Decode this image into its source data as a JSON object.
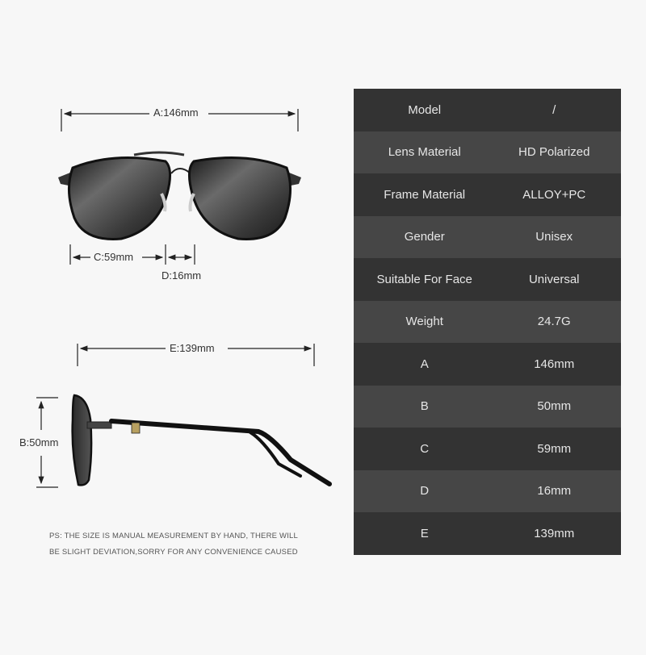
{
  "diagram": {
    "front_view": {
      "width_label": "A:146mm",
      "lens_width_label": "C:59mm",
      "bridge_label": "D:16mm"
    },
    "side_view": {
      "temple_length_label": "E:139mm",
      "lens_height_label": "B:50mm"
    },
    "note_lines": [
      "PS: THE SIZE IS MANUAL MEASUREMENT BY HAND, THERE WILL",
      "BE SLIGHT DEVIATION,SORRY FOR ANY CONVENIENCE CAUSED"
    ]
  },
  "specs": [
    {
      "label": "Model",
      "value": "/"
    },
    {
      "label": "Lens Material",
      "value": "HD Polarized"
    },
    {
      "label": "Frame Material",
      "value": "ALLOY+PC"
    },
    {
      "label": "Gender",
      "value": "Unisex"
    },
    {
      "label": "Suitable For Face",
      "value": "Universal"
    },
    {
      "label": "Weight",
      "value": "24.7G"
    },
    {
      "label": "A",
      "value": "146mm"
    },
    {
      "label": "B",
      "value": "50mm"
    },
    {
      "label": "C",
      "value": "59mm"
    },
    {
      "label": "D",
      "value": "16mm"
    },
    {
      "label": "E",
      "value": "139mm"
    }
  ],
  "colors": {
    "background": "#f7f7f7",
    "row_dark": "#333333",
    "row_light": "#464646",
    "text_light": "#e6e6e6"
  }
}
